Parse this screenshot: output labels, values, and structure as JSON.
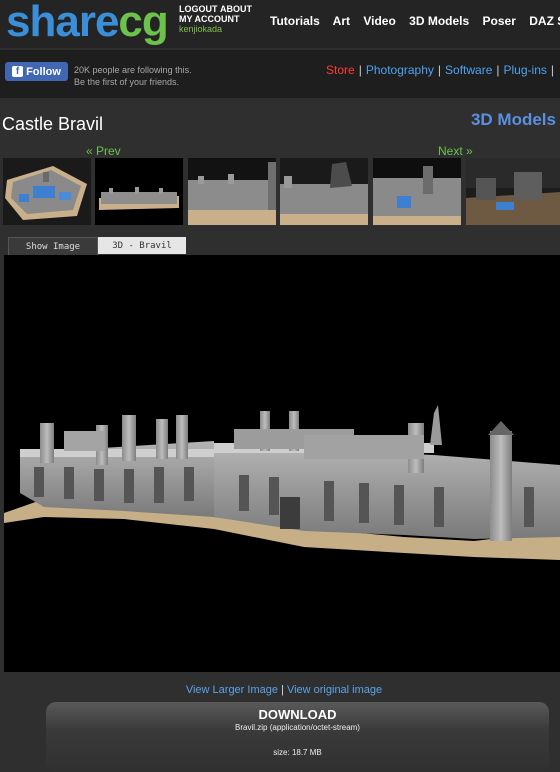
{
  "header": {
    "logo_share": "share",
    "logo_cg": "cg",
    "logout": "LOGOUT",
    "about": "ABOUT",
    "my_account": "MY ACCOUNT",
    "username": "kenjiokada",
    "nav": [
      "Tutorials",
      "Art",
      "Video",
      "3D Models",
      "Poser",
      "DAZ St"
    ]
  },
  "social": {
    "follow_label": "Follow",
    "fb_icon": "f",
    "follow_line1": "20K people are following this.",
    "follow_line2": "Be the first of your friends.",
    "store": "Store",
    "links": [
      "Photography",
      "Software",
      "Plug-ins"
    ]
  },
  "page": {
    "title": "Castle Bravil",
    "section": "3D Models",
    "prev": "« Prev",
    "next": "Next »"
  },
  "tabs": {
    "show_image": "Show Image",
    "model_view": "3D - Bravil"
  },
  "image_links": {
    "larger": "View Larger Image",
    "sep": "|",
    "original": "View original image"
  },
  "download": {
    "title": "DOWNLOAD",
    "file": "Bravil.zip (application/octet-stream)",
    "size": "size: 18.7 MB"
  },
  "colors": {
    "logo_blue": "#3a8fd8",
    "logo_green": "#6cc24a",
    "link_blue": "#4ea3f0",
    "store_red": "#ff3b30",
    "section_blue": "#5b8fe0"
  }
}
